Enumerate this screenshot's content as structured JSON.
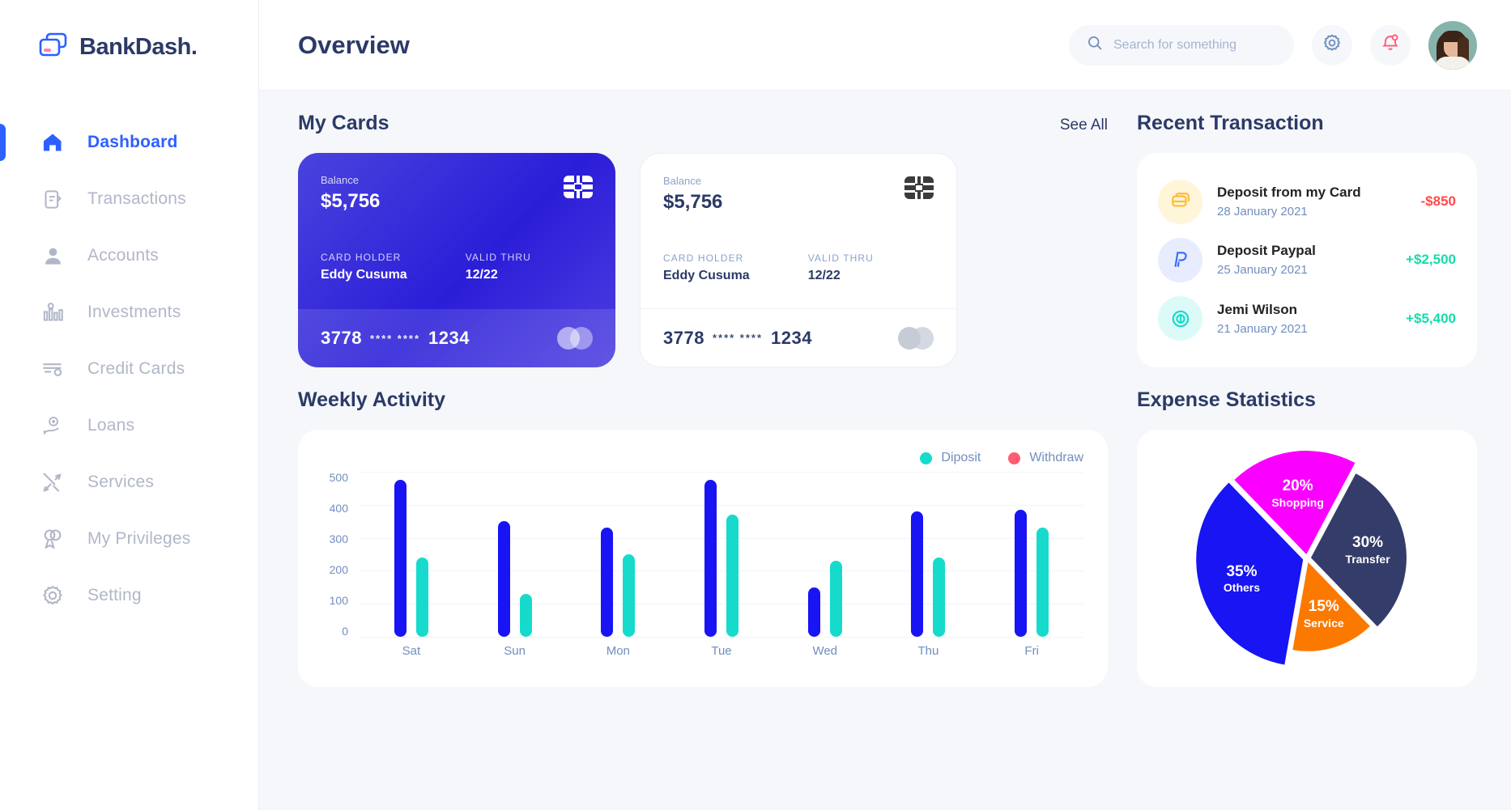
{
  "brand": {
    "name": "BankDash.",
    "logo_icon": "card-stack-icon"
  },
  "sidebar": {
    "items": [
      {
        "label": "Dashboard",
        "icon": "home-icon",
        "active": true
      },
      {
        "label": "Transactions",
        "icon": "transfer-icon",
        "active": false
      },
      {
        "label": "Accounts",
        "icon": "user-icon",
        "active": false
      },
      {
        "label": "Investments",
        "icon": "bar-chart-icon",
        "active": false
      },
      {
        "label": "Credit Cards",
        "icon": "credit-card-icon",
        "active": false
      },
      {
        "label": "Loans",
        "icon": "loan-hand-icon",
        "active": false
      },
      {
        "label": "Services",
        "icon": "tools-icon",
        "active": false
      },
      {
        "label": "My Privileges",
        "icon": "award-icon",
        "active": false
      },
      {
        "label": "Setting",
        "icon": "gear-icon",
        "active": false
      }
    ]
  },
  "header": {
    "title": "Overview",
    "search": {
      "placeholder": "Search for something",
      "value": "",
      "icon": "search-icon"
    },
    "settings_icon": "gear-icon",
    "notification_icon": "bell-icon",
    "avatar": "user-avatar"
  },
  "my_cards": {
    "title": "My Cards",
    "see_all": "See All",
    "cards": [
      {
        "theme": "blue",
        "balance_label": "Balance",
        "balance": "$5,756",
        "holder_label": "CARD HOLDER",
        "holder": "Eddy Cusuma",
        "valid_label": "VALID THRU",
        "valid": "12/22",
        "number_prefix": "3778",
        "number_mask": "**** ****",
        "number_suffix": "1234"
      },
      {
        "theme": "white",
        "balance_label": "Balance",
        "balance": "$5,756",
        "holder_label": "CARD HOLDER",
        "holder": "Eddy Cusuma",
        "valid_label": "VALID THRU",
        "valid": "12/22",
        "number_prefix": "3778",
        "number_mask": "**** ****",
        "number_suffix": "1234"
      }
    ]
  },
  "recent_transaction": {
    "title": "Recent Transaction",
    "items": [
      {
        "icon": "card-deposit-icon",
        "icon_bg": "#fff5d9",
        "icon_color": "#ffbb38",
        "title": "Deposit from my Card",
        "date": "28 January 2021",
        "amount": "-$850",
        "amount_color": "#ff4b4a"
      },
      {
        "icon": "paypal-icon",
        "icon_bg": "#e7edff",
        "icon_color": "#396aff",
        "title": "Deposit Paypal",
        "date": "25 January 2021",
        "amount": "+$2,500",
        "amount_color": "#16dbaa"
      },
      {
        "icon": "dollar-circle-icon",
        "icon_bg": "#dcfaf8",
        "icon_color": "#16dbcc",
        "title": "Jemi Wilson",
        "date": "21 January 2021",
        "amount": "+$5,400",
        "amount_color": "#16dbaa"
      }
    ]
  },
  "weekly_activity": {
    "title": "Weekly Activity"
  },
  "expense_statistics": {
    "title": "Expense Statistics"
  },
  "chart_data": [
    {
      "type": "bar",
      "title": "Weekly Activity",
      "categories": [
        "Sat",
        "Sun",
        "Mon",
        "Tue",
        "Wed",
        "Thu",
        "Fri"
      ],
      "series": [
        {
          "name": "Withdraw",
          "color": "#1814f3",
          "values": [
            475,
            350,
            330,
            475,
            150,
            380,
            385
          ]
        },
        {
          "name": "Diposit",
          "color": "#16dbcc",
          "values": [
            240,
            130,
            250,
            370,
            230,
            240,
            330
          ]
        }
      ],
      "legend": [
        {
          "label": "Diposit",
          "color": "#16dbcc"
        },
        {
          "label": "Withdraw",
          "color": "#fe5c73"
        }
      ],
      "yticks": [
        500,
        400,
        300,
        200,
        100,
        0
      ],
      "ylim": [
        0,
        500
      ],
      "xlabel": "",
      "ylabel": "",
      "grid": true,
      "legend_position": "top-right"
    },
    {
      "type": "pie",
      "title": "Expense Statistics",
      "slices": [
        {
          "label": "Transfer",
          "percent": 30,
          "color": "#343c6a"
        },
        {
          "label": "Service",
          "percent": 15,
          "color": "#fc7900"
        },
        {
          "label": "Others",
          "percent": 35,
          "color": "#1814f3"
        },
        {
          "label": "Shopping",
          "percent": 20,
          "color": "#fa00ff"
        }
      ],
      "legend_position": "on-slice"
    }
  ],
  "colors": {
    "accent": "#2d60ff",
    "title": "#2b3a67",
    "muted": "#718ebf",
    "deposit": "#16dbcc",
    "withdraw": "#1814f3",
    "withdraw_legend": "#fe5c73",
    "bg": "#f5f7fa"
  }
}
